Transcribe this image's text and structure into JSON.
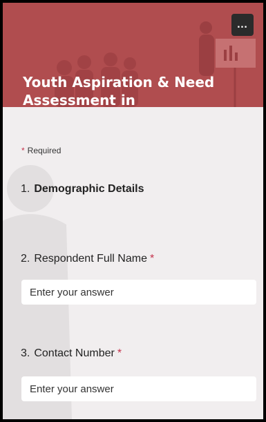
{
  "header": {
    "title": "Youth Aspiration & Need Assessment in Ludhiana(East)",
    "more_label": "…",
    "banner_color": "#b04d4f"
  },
  "required_label": "Required",
  "questions": [
    {
      "number": "1.",
      "text": "Demographic Details",
      "required": false
    },
    {
      "number": "2.",
      "text": "Respondent Full Name",
      "required": true,
      "placeholder": "Enter your answer"
    },
    {
      "number": "3.",
      "text": "Contact Number",
      "required": true,
      "placeholder": "Enter your answer"
    }
  ],
  "required_marker": "*",
  "colors": {
    "accent": "#b04d4f",
    "required_star": "#c4314b",
    "page_bg": "#f1eeef"
  }
}
